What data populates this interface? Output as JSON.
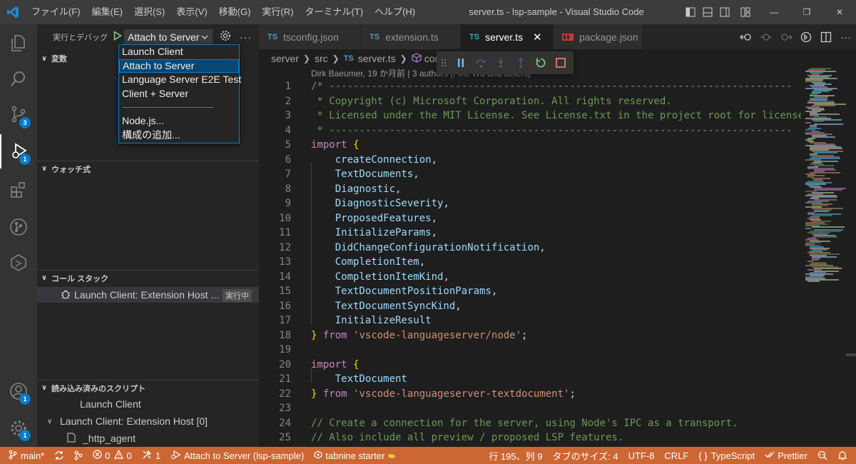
{
  "titlebar": {
    "menu": [
      "ファイル(F)",
      "編集(E)",
      "選択(S)",
      "表示(V)",
      "移動(G)",
      "実行(R)",
      "ターミナル(T)",
      "ヘルプ(H)"
    ],
    "title": "server.ts - lsp-sample - Visual Studio Code"
  },
  "activity_badges": {
    "scm": "3",
    "debug": "1",
    "account": "1",
    "manage": "1"
  },
  "sidebar": {
    "run_title": "実行とデバッグ",
    "selected_config": "Attach to Server",
    "more": "···",
    "sections": {
      "variables": "変数",
      "watch": "ウォッチ式",
      "callstack": "コール スタック",
      "loaded_scripts": "読み込み済みのスクリプト"
    },
    "callstack_item": {
      "label": "Launch Client: Extension Host ...",
      "badge": "実行中"
    },
    "loaded_scripts": [
      "Launch Client",
      "Launch Client: Extension Host [0]",
      "_http_agent"
    ]
  },
  "dropdown": {
    "items": [
      "Launch Client",
      "Attach to Server",
      "Language Server E2E Test",
      "Client + Server"
    ],
    "extra": [
      "Node.js...",
      "構成の追加..."
    ]
  },
  "tabs": [
    {
      "label": "tsconfig.json",
      "icon": "json-icon"
    },
    {
      "label": "extension.ts",
      "icon": "ts-icon"
    },
    {
      "label": "server.ts",
      "icon": "ts-icon",
      "active": true
    },
    {
      "label": "package.json",
      "icon": "npm-icon"
    }
  ],
  "tab_icon_text": {
    "ts": "TS",
    "json": "{}",
    "close": "✕"
  },
  "breadcrumb": {
    "parts": [
      "server",
      "src",
      "server.ts",
      "conn"
    ]
  },
  "codelens": "Dirk Baeumer, 19 か月前 | 3 authors (Fine Wu and others)",
  "code_lines": [
    {
      "n": "1",
      "html": [
        [
          "cm",
          "/* -----------------------------------------------------------------------------"
        ]
      ]
    },
    {
      "n": "2",
      "html": [
        [
          "cm",
          " * Copyright (c) Microsoft Corporation. All rights reserved."
        ]
      ]
    },
    {
      "n": "3",
      "html": [
        [
          "cm",
          " * Licensed under the MIT License. See License.txt in the project root for license"
        ]
      ]
    },
    {
      "n": "4",
      "html": [
        [
          "cm",
          " * -----------------------------------------------------------------------------"
        ]
      ]
    },
    {
      "n": "5",
      "html": [
        [
          "kw",
          "import"
        ],
        [
          "pn",
          " "
        ],
        [
          "br",
          "{"
        ]
      ]
    },
    {
      "n": "6",
      "html": [
        [
          "pn",
          "    "
        ],
        [
          "id",
          "createConnection"
        ],
        [
          "pn",
          ","
        ]
      ]
    },
    {
      "n": "7",
      "html": [
        [
          "pn",
          "    "
        ],
        [
          "id",
          "TextDocuments"
        ],
        [
          "pn",
          ","
        ]
      ]
    },
    {
      "n": "8",
      "html": [
        [
          "pn",
          "    "
        ],
        [
          "id",
          "Diagnostic"
        ],
        [
          "pn",
          ","
        ]
      ]
    },
    {
      "n": "9",
      "html": [
        [
          "pn",
          "    "
        ],
        [
          "id",
          "DiagnosticSeverity"
        ],
        [
          "pn",
          ","
        ]
      ]
    },
    {
      "n": "10",
      "html": [
        [
          "pn",
          "    "
        ],
        [
          "id",
          "ProposedFeatures"
        ],
        [
          "pn",
          ","
        ]
      ]
    },
    {
      "n": "11",
      "html": [
        [
          "pn",
          "    "
        ],
        [
          "id",
          "InitializeParams"
        ],
        [
          "pn",
          ","
        ]
      ]
    },
    {
      "n": "12",
      "html": [
        [
          "pn",
          "    "
        ],
        [
          "id",
          "DidChangeConfigurationNotification"
        ],
        [
          "pn",
          ","
        ]
      ]
    },
    {
      "n": "13",
      "html": [
        [
          "pn",
          "    "
        ],
        [
          "id",
          "CompletionItem"
        ],
        [
          "pn",
          ","
        ]
      ]
    },
    {
      "n": "14",
      "html": [
        [
          "pn",
          "    "
        ],
        [
          "id",
          "CompletionItemKind"
        ],
        [
          "pn",
          ","
        ]
      ]
    },
    {
      "n": "15",
      "html": [
        [
          "pn",
          "    "
        ],
        [
          "id",
          "TextDocumentPositionParams"
        ],
        [
          "pn",
          ","
        ]
      ]
    },
    {
      "n": "16",
      "html": [
        [
          "pn",
          "    "
        ],
        [
          "id",
          "TextDocumentSyncKind"
        ],
        [
          "pn",
          ","
        ]
      ]
    },
    {
      "n": "17",
      "html": [
        [
          "pn",
          "    "
        ],
        [
          "id",
          "InitializeResult"
        ]
      ]
    },
    {
      "n": "18",
      "html": [
        [
          "br",
          "}"
        ],
        [
          "pn",
          " "
        ],
        [
          "kw",
          "from"
        ],
        [
          "pn",
          " "
        ],
        [
          "st",
          "'vscode-languageserver/node'"
        ],
        [
          "pn",
          ";"
        ]
      ]
    },
    {
      "n": "19",
      "html": []
    },
    {
      "n": "20",
      "html": [
        [
          "kw",
          "import"
        ],
        [
          "pn",
          " "
        ],
        [
          "br",
          "{"
        ]
      ]
    },
    {
      "n": "21",
      "html": [
        [
          "pn",
          "    "
        ],
        [
          "id",
          "TextDocument"
        ]
      ]
    },
    {
      "n": "22",
      "html": [
        [
          "br",
          "}"
        ],
        [
          "pn",
          " "
        ],
        [
          "kw",
          "from"
        ],
        [
          "pn",
          " "
        ],
        [
          "st",
          "'vscode-languageserver-textdocument'"
        ],
        [
          "pn",
          ";"
        ]
      ]
    },
    {
      "n": "23",
      "html": []
    },
    {
      "n": "24",
      "html": [
        [
          "cm",
          "// Create a connection for the server, using Node's IPC as a transport."
        ]
      ]
    },
    {
      "n": "25",
      "html": [
        [
          "cm",
          "// Also include all preview / proposed LSP features."
        ]
      ]
    }
  ],
  "statusbar": {
    "branch": "main*",
    "errors": "0",
    "warnings": "0",
    "tools": "1",
    "debug_target": "Attach to Server (lsp-sample)",
    "tabnine": "tabnine starter",
    "position": "行 195、列 9",
    "tab_size": "タブのサイズ: 4",
    "encoding": "UTF-8",
    "eol": "CRLF",
    "language": "TypeScript",
    "prettier": "Prettier"
  },
  "colors": {
    "accent": "#007acc",
    "statusbar": "#cc6633"
  }
}
